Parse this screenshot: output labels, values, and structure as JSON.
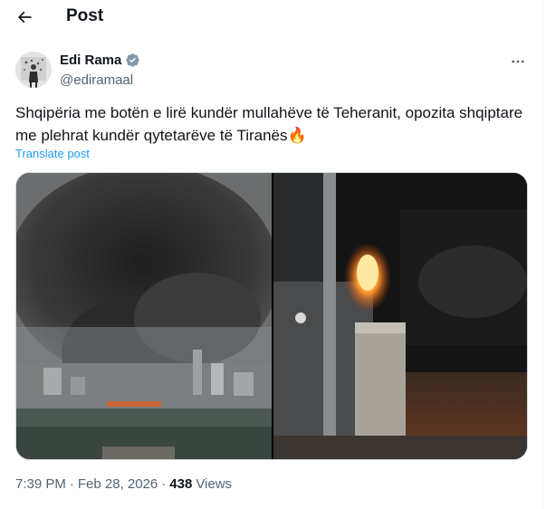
{
  "header": {
    "title": "Post",
    "back_icon": "arrow-left-icon"
  },
  "author": {
    "name": "Edi Rama",
    "handle": "@ediramaal",
    "verified": true,
    "verified_color": "#829aab"
  },
  "more_icon": "more-horizontal-icon",
  "post": {
    "text": "Shqipëria me botën e lirë kundër mullahëve të Teheranit, opozita shqiptare me plehrat kundër qytetarëve të Tiranës🔥",
    "translate_label": "Translate post",
    "accent": "#1d9bf0"
  },
  "media": {
    "left_image": "city-smoke-fire-photo",
    "right_image": "street-electrical-box-fire-photo"
  },
  "meta": {
    "time": "7:39 PM",
    "sep1": "·",
    "date": "Feb 28, 2026",
    "sep2": "·",
    "views_count": "438",
    "views_label": "Views"
  }
}
